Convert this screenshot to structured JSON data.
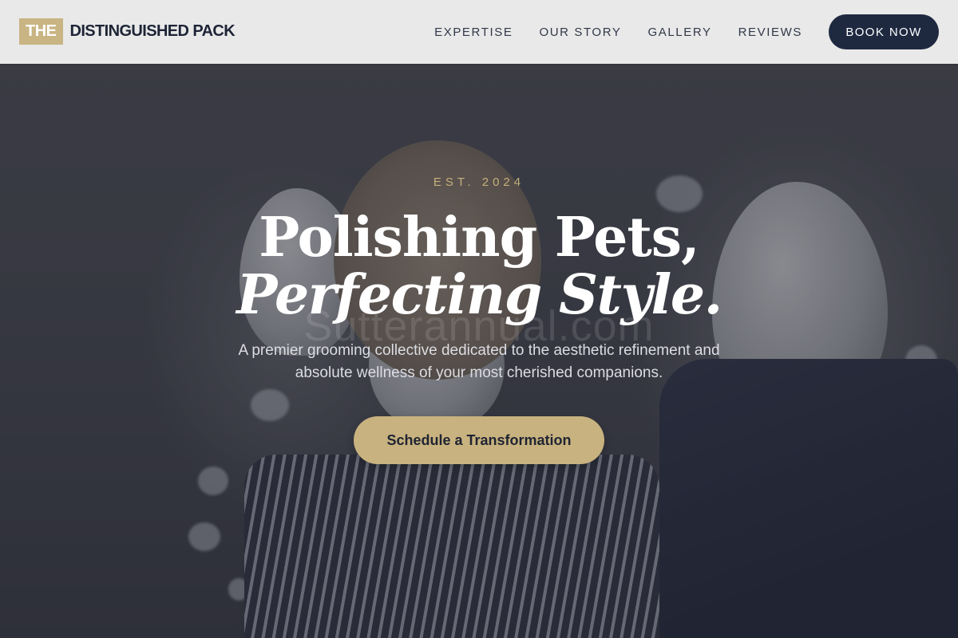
{
  "brand": {
    "badge": "THE",
    "name": "DISTINGUISHED PACK",
    "badge_color": "#c9b483",
    "name_color": "#1d2436"
  },
  "nav": {
    "links": [
      {
        "label": "EXPERTISE"
      },
      {
        "label": "OUR STORY"
      },
      {
        "label": "GALLERY"
      },
      {
        "label": "REVIEWS"
      }
    ],
    "cta_label": "BOOK NOW",
    "cta_color": "#1e2940"
  },
  "hero": {
    "eyebrow": "EST. 2024",
    "headline_line1": "Polishing Pets,",
    "headline_line2": "Perfecting Style.",
    "watermark": "Sutterannual.com",
    "subtitle": "A premier grooming collective dedicated to the aesthetic refinement and absolute wellness of your most cherished companions.",
    "cta_label": "Schedule a Transformation",
    "accent_color": "#c8b27f",
    "background_image": "boutique-mannequins-photo"
  }
}
